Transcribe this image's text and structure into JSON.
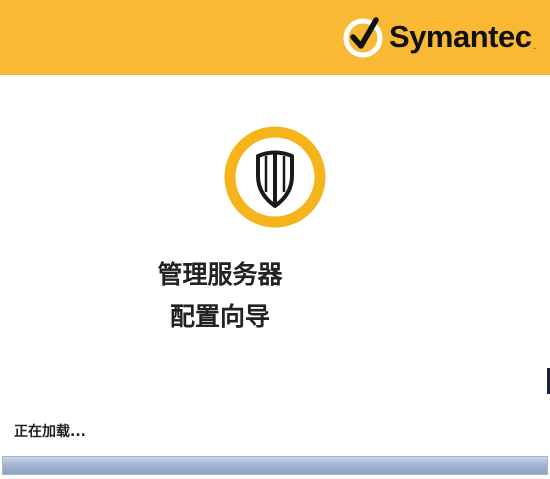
{
  "header": {
    "brand_name": "Symantec",
    "brand_tm": ".",
    "background_color": "#f9b934"
  },
  "main": {
    "title_line1": "管理服务器",
    "title_line2": "配置向导",
    "emblem_icon": "shield-icon"
  },
  "footer": {
    "status_text": "正在加载...",
    "progress_percent": 100
  }
}
